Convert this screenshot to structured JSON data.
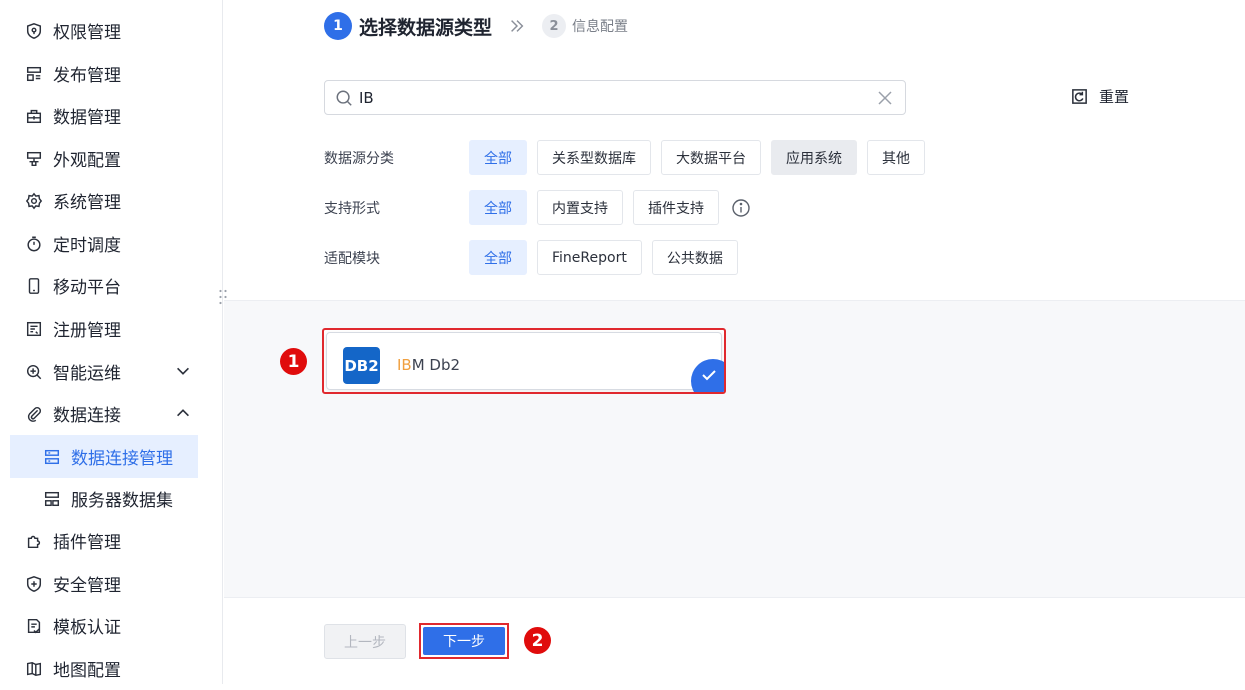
{
  "sidebar": {
    "items": [
      {
        "label": "权限管理",
        "icon": "permission-shield-icon"
      },
      {
        "label": "发布管理",
        "icon": "publish-icon"
      },
      {
        "label": "数据管理",
        "icon": "data-manage-icon"
      },
      {
        "label": "外观配置",
        "icon": "appearance-icon"
      },
      {
        "label": "系统管理",
        "icon": "gear-icon"
      },
      {
        "label": "定时调度",
        "icon": "timer-icon"
      },
      {
        "label": "移动平台",
        "icon": "mobile-icon"
      },
      {
        "label": "注册管理",
        "icon": "register-icon"
      },
      {
        "label": "智能运维",
        "icon": "ops-icon",
        "expanded": false
      },
      {
        "label": "数据连接",
        "icon": "paperclip-icon",
        "expanded": true
      },
      {
        "label": "数据连接管理",
        "icon": "db-connection-icon",
        "active": true
      },
      {
        "label": "服务器数据集",
        "icon": "server-dataset-icon"
      },
      {
        "label": "插件管理",
        "icon": "plugin-icon"
      },
      {
        "label": "安全管理",
        "icon": "security-shield-icon"
      },
      {
        "label": "模板认证",
        "icon": "template-cert-icon"
      },
      {
        "label": "地图配置",
        "icon": "map-icon"
      }
    ]
  },
  "steps": {
    "step1": {
      "num": "1",
      "label": "选择数据源类型"
    },
    "step2": {
      "num": "2",
      "label": "信息配置"
    }
  },
  "search": {
    "value": "IB",
    "placeholder": ""
  },
  "reset_label": "重置",
  "filters": {
    "category": {
      "label": "数据源分类",
      "options": [
        "全部",
        "关系型数据库",
        "大数据平台",
        "应用系统",
        "其他"
      ],
      "selected": "全部"
    },
    "support": {
      "label": "支持形式",
      "options": [
        "全部",
        "内置支持",
        "插件支持"
      ],
      "selected": "全部"
    },
    "module": {
      "label": "适配模块",
      "options": [
        "全部",
        "FineReport",
        "公共数据"
      ],
      "selected": "全部"
    }
  },
  "result": {
    "logo_text": "DB2",
    "name_highlight": "IB",
    "name_rest": "M Db2",
    "selected": true
  },
  "markers": {
    "m1": "1",
    "m2": "2"
  },
  "footer": {
    "prev_label": "上一步",
    "next_label": "下一步"
  },
  "colors": {
    "accent": "#2f6fe8",
    "marker": "#e00c0c",
    "db2_logo": "#1466c8",
    "highlight": "#f0a040"
  }
}
